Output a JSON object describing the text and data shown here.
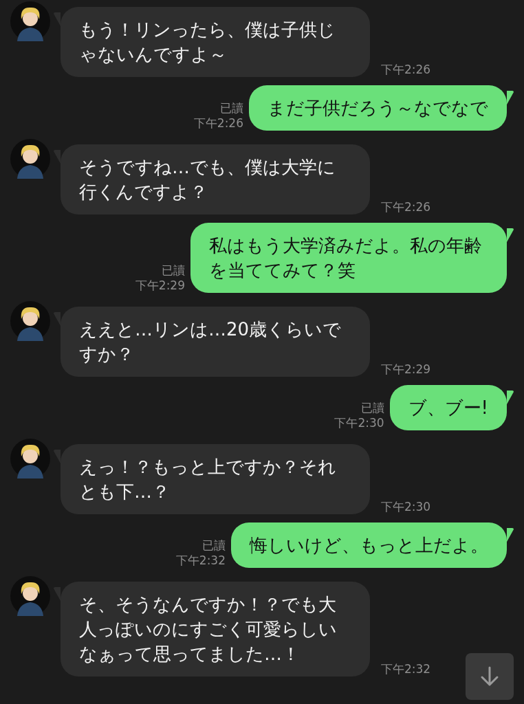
{
  "messages": [
    {
      "kind": "incoming",
      "text": "もう！リンったら、僕は子供じゃないんですよ～",
      "time": "下午2:26"
    },
    {
      "kind": "outgoing",
      "text": "まだ子供だろう～なでなで",
      "read": "已讀",
      "time": "下午2:26"
    },
    {
      "kind": "incoming",
      "text": "そうですね…でも、僕は大学に行くんですよ？",
      "time": "下午2:26"
    },
    {
      "kind": "outgoing",
      "text": "私はもう大学済みだよ。私の年齢を当ててみて？笑",
      "read": "已讀",
      "time": "下午2:29"
    },
    {
      "kind": "incoming",
      "text": "ええと…リンは…20歳くらいですか？",
      "time": "下午2:29"
    },
    {
      "kind": "outgoing",
      "text": "ブ、ブー!",
      "read": "已讀",
      "time": "下午2:30"
    },
    {
      "kind": "incoming",
      "text": "えっ！？もっと上ですか？それとも下…？",
      "time": "下午2:30"
    },
    {
      "kind": "outgoing",
      "text": "悔しいけど、もっと上だよ。",
      "read": "已讀",
      "time": "下午2:32"
    },
    {
      "kind": "incoming",
      "text": "そ、そうなんですか！？でも大人っぽいのにすごく可愛らしいなぁって思ってました…！",
      "time": "下午2:32"
    }
  ]
}
